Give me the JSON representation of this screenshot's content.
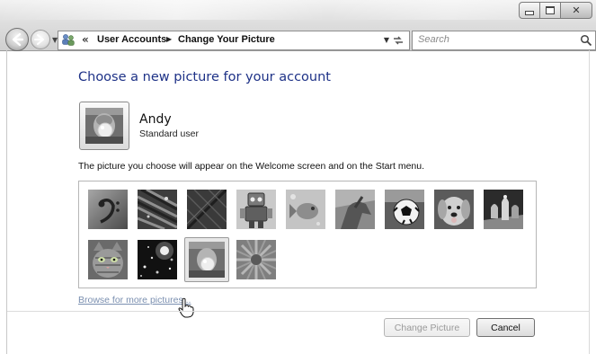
{
  "address_bar": {
    "overflow": "«",
    "crumbs": [
      "User Accounts",
      "Change Your Picture"
    ]
  },
  "search": {
    "placeholder": "Search"
  },
  "content": {
    "heading": "Choose a new picture for your account",
    "user": {
      "name": "Andy",
      "role": "Standard user"
    },
    "info": "The picture you choose will appear on the Welcome screen and on the Start menu.",
    "pictures": [
      {
        "name": "bass-clef-picture"
      },
      {
        "name": "beach-chairs-picture"
      },
      {
        "name": "leaf-picture"
      },
      {
        "name": "robot-picture"
      },
      {
        "name": "fish-picture"
      },
      {
        "name": "horse-picture"
      },
      {
        "name": "soccer-ball-picture"
      },
      {
        "name": "puppy-picture"
      },
      {
        "name": "chess-picture"
      },
      {
        "name": "kitten-picture"
      },
      {
        "name": "sparkles-picture"
      },
      {
        "name": "gum-bubble-picture",
        "selected": true
      },
      {
        "name": "flower-picture"
      }
    ],
    "browse_link": "Browse for more pictures..."
  },
  "buttons": {
    "change_picture": "Change Picture",
    "cancel": "Cancel"
  }
}
